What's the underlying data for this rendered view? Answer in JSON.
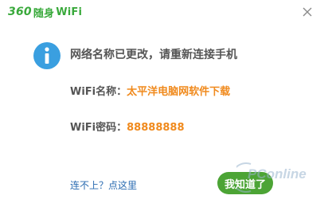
{
  "app": {
    "brand_number": "360",
    "brand_chinese": "随身",
    "brand_suffix": "WiFi"
  },
  "dialog": {
    "message": "网络名称已更改，请重新连接手机",
    "wifi_name_label": "WiFi名称：",
    "wifi_name_value": "太平洋电脑网软件下载",
    "wifi_password_label": "WiFi密码：",
    "wifi_password_value": "88888888",
    "help_link": "连不上？点这里",
    "ok_button": "我知道了"
  },
  "watermark": {
    "brand": "PConline"
  },
  "colors": {
    "brand_green": "#39a93b",
    "button_green": "#4ca435",
    "info_blue": "#3a9fe0",
    "value_orange": "#f08a1d",
    "link_blue": "#2a6bb1",
    "text_gray": "#555555"
  },
  "icons": {
    "info": "info-icon",
    "close": "close-icon"
  }
}
